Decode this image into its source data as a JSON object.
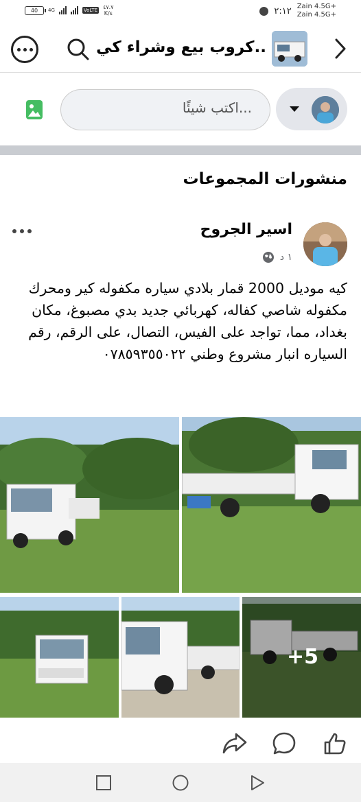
{
  "status_bar": {
    "time": "٢:١٢",
    "carrier_1": "Zain 4.5G+",
    "carrier_2": "Zain 4.5G+",
    "battery": "40",
    "network": "4G",
    "volte": "VoLTE",
    "speed_value": "٤٧.٧",
    "speed_unit": "K/s"
  },
  "header": {
    "group_title": "كروب بيع وشراء كي..",
    "back_icon": "chevron-right-icon",
    "search_icon": "search-icon",
    "more_icon": "more-circle-icon"
  },
  "composer": {
    "placeholder": "اكتب شيئًا...",
    "photo_icon": "photo-icon"
  },
  "feed": {
    "section_title": "منشورات المجموعات",
    "post": {
      "author": "اسير الجروح",
      "time": "١ د",
      "privacy_icon": "globe-icon",
      "text": "كيه موديل 2000 قمار بلادي سياره مكفوله كير ومحرك مكفوله شاصي كفاله، كهربائي جديد بدي مصبوغ، مكان بغداد، مما، تواجد على الفيس، التصال، على الرقم، رقم السياره انبار مشروع وطني ٠٧٨٥٩٣٥٥٠٢٢",
      "more_photos": "+5",
      "actions": {
        "like_icon": "thumbs-up-icon",
        "comment_icon": "comment-icon",
        "share_icon": "share-icon"
      }
    }
  },
  "navbar": {
    "recents_icon": "square-icon",
    "home_icon": "circle-icon",
    "back_icon": "triangle-back-icon"
  },
  "colors": {
    "text": "#050505",
    "secondary_text": "#65676b",
    "divider": "#c9ccd1",
    "input_bg": "#f0f2f5",
    "photo_green": "#45bd62"
  }
}
